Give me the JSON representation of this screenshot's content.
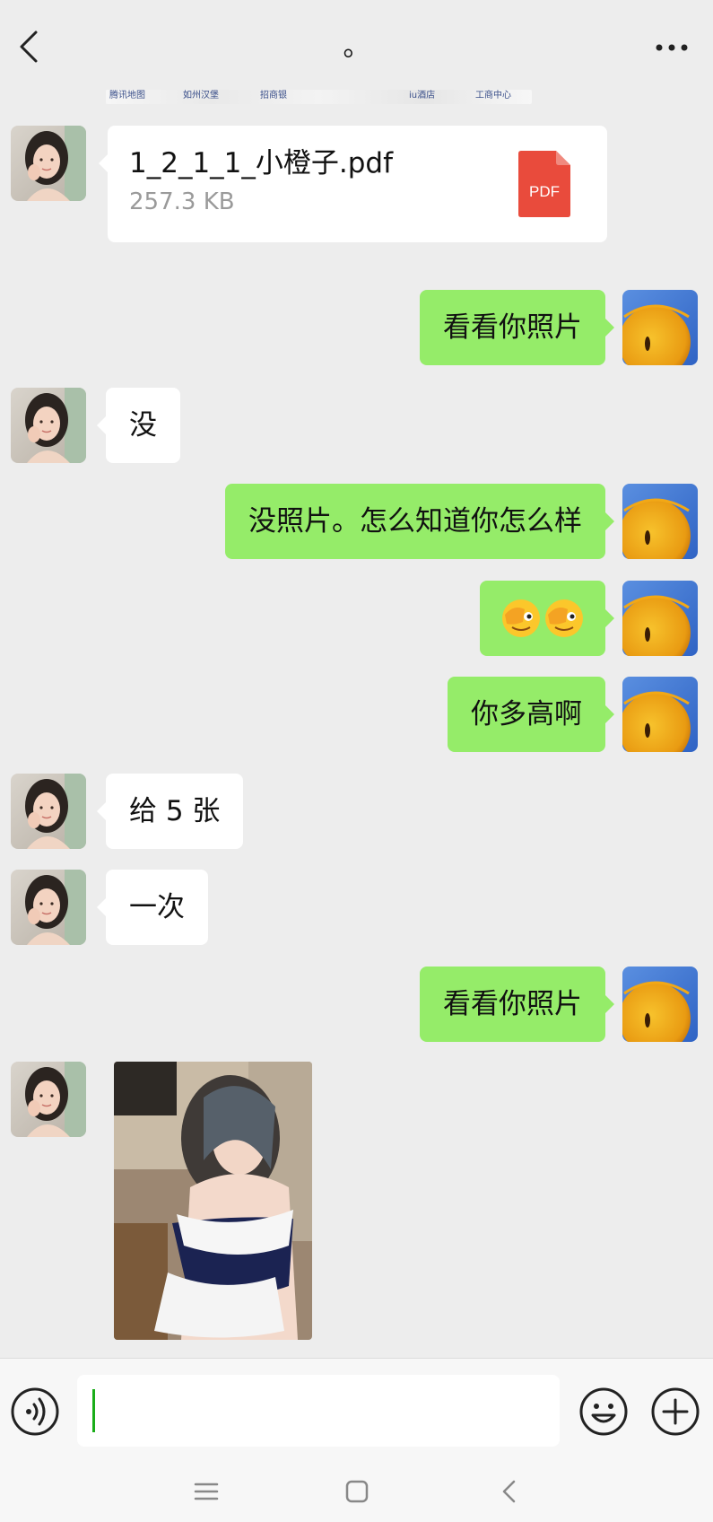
{
  "header": {
    "title": "。"
  },
  "strip": {
    "items": [
      "腾讯地图",
      "如州汉堡",
      "招商银",
      "iu酒店",
      "工商中心"
    ]
  },
  "file": {
    "name": "1_2_1_1_小橙子.pdf",
    "size": "257.3 KB",
    "badge": "PDF"
  },
  "messages": [
    {
      "from": "me",
      "text": "看看你照片"
    },
    {
      "from": "her",
      "text": "没"
    },
    {
      "from": "me",
      "text": "没照片。怎么知道你怎么样"
    },
    {
      "from": "me",
      "text": "[emoji][emoji]",
      "emoji": [
        "face-covering-eye-emoji",
        "face-covering-eye-emoji"
      ]
    },
    {
      "from": "me",
      "text": "你多高啊"
    },
    {
      "from": "her",
      "text": "给 5 张"
    },
    {
      "from": "her",
      "text": "一次"
    },
    {
      "from": "me",
      "text": "看看你照片"
    }
  ],
  "input": {
    "value": "",
    "placeholder": ""
  },
  "colors": {
    "background": "#ededed",
    "outgoing": "#95ec69",
    "incoming": "#ffffff",
    "pdf": "#e94b3c",
    "caret": "#1aad19"
  },
  "icons": {
    "back": "chevron-left-icon",
    "more": "more-dots-icon",
    "voice": "voice-icon",
    "emoji": "emoji-icon",
    "plus": "plus-icon",
    "nav": [
      "menu-icon",
      "home-square-icon",
      "back-triangle-icon"
    ]
  }
}
